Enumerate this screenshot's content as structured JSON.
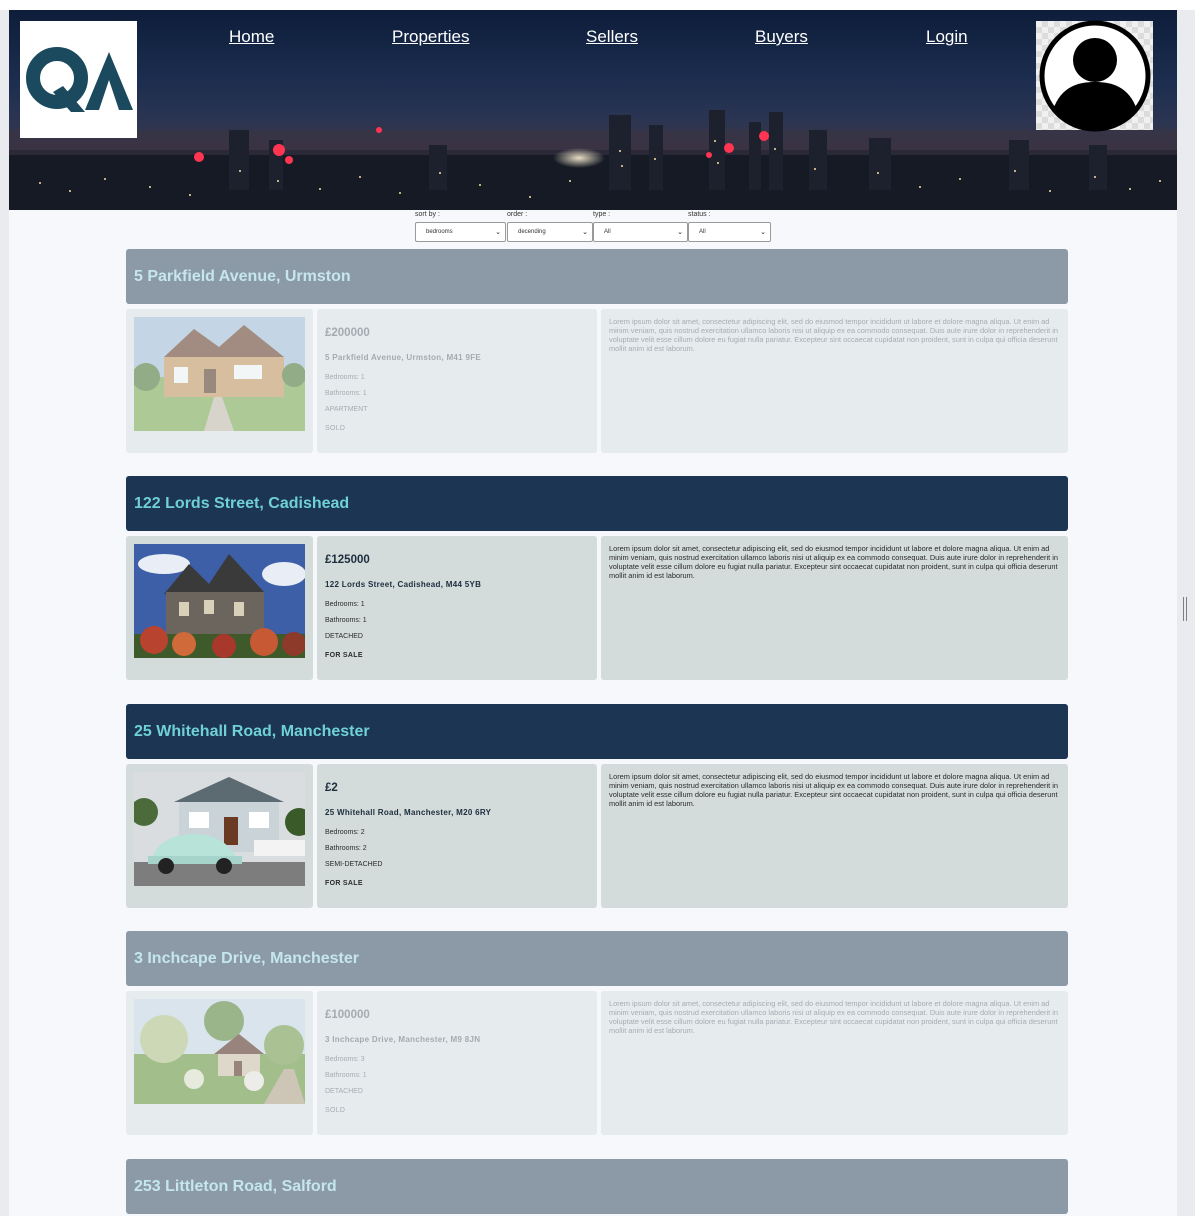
{
  "nav": {
    "home": "Home",
    "properties": "Properties",
    "sellers": "Sellers",
    "buyers": "Buyers",
    "login": "Login"
  },
  "logo_text": "QA",
  "filters": {
    "sort_label": "sort by :",
    "sort_value": "bedrooms",
    "order_label": "order :",
    "order_value": "decending",
    "type_label": "type :",
    "type_value": "All",
    "status_label": "status :",
    "status_value": "All"
  },
  "description": "Lorem ipsum dolor sit amet, consectetur adipiscing elit, sed do eiusmod tempor incididunt ut labore et dolore magna aliqua. Ut enim ad minim veniam, quis nostrud exercitation ullamco laboris nisi ut aliquip ex ea commodo consequat. Duis aute irure dolor in reprehenderit in voluptate velit esse cillum dolore eu fugiat nulla pariatur. Excepteur sint occaecat cupidatat non proident, sunt in culpa qui officia deserunt mollit anim id est laborum.",
  "listings": [
    {
      "title": "5 Parkfield Avenue, Urmston",
      "price": "£200000",
      "address": "5 Parkfield Avenue, Urmston, M41 9FE",
      "bedrooms": "Bedrooms: 1",
      "bathrooms": "Bathrooms: 1",
      "type": "APARTMENT",
      "status": "SOLD",
      "photo": "brick-house-photo"
    },
    {
      "title": "122 Lords Street, Cadishead",
      "price": "£125000",
      "address": "122 Lords Street, Cadishead, M44 5YB",
      "bedrooms": "Bedrooms: 1",
      "bathrooms": "Bathrooms: 1",
      "type": "DETACHED",
      "status": "FOR SALE",
      "photo": "stone-house-photo"
    },
    {
      "title": "25 Whitehall Road, Manchester",
      "price": "£2",
      "address": "25 Whitehall Road, Manchester, M20 6RY",
      "bedrooms": "Bedrooms: 2",
      "bathrooms": "Bathrooms: 2",
      "type": "SEMI-DETACHED",
      "status": "FOR SALE",
      "photo": "house-with-beetle-car-photo"
    },
    {
      "title": "3 Inchcape Drive, Manchester",
      "price": "£100000",
      "address": "3 Inchcape Drive, Manchester, M9 8JN",
      "bedrooms": "Bedrooms: 3",
      "bathrooms": "Bathrooms: 1",
      "type": "DETACHED",
      "status": "SOLD",
      "photo": "cottage-garden-photo"
    },
    {
      "title": "253 Littleton Road, Salford"
    }
  ]
}
